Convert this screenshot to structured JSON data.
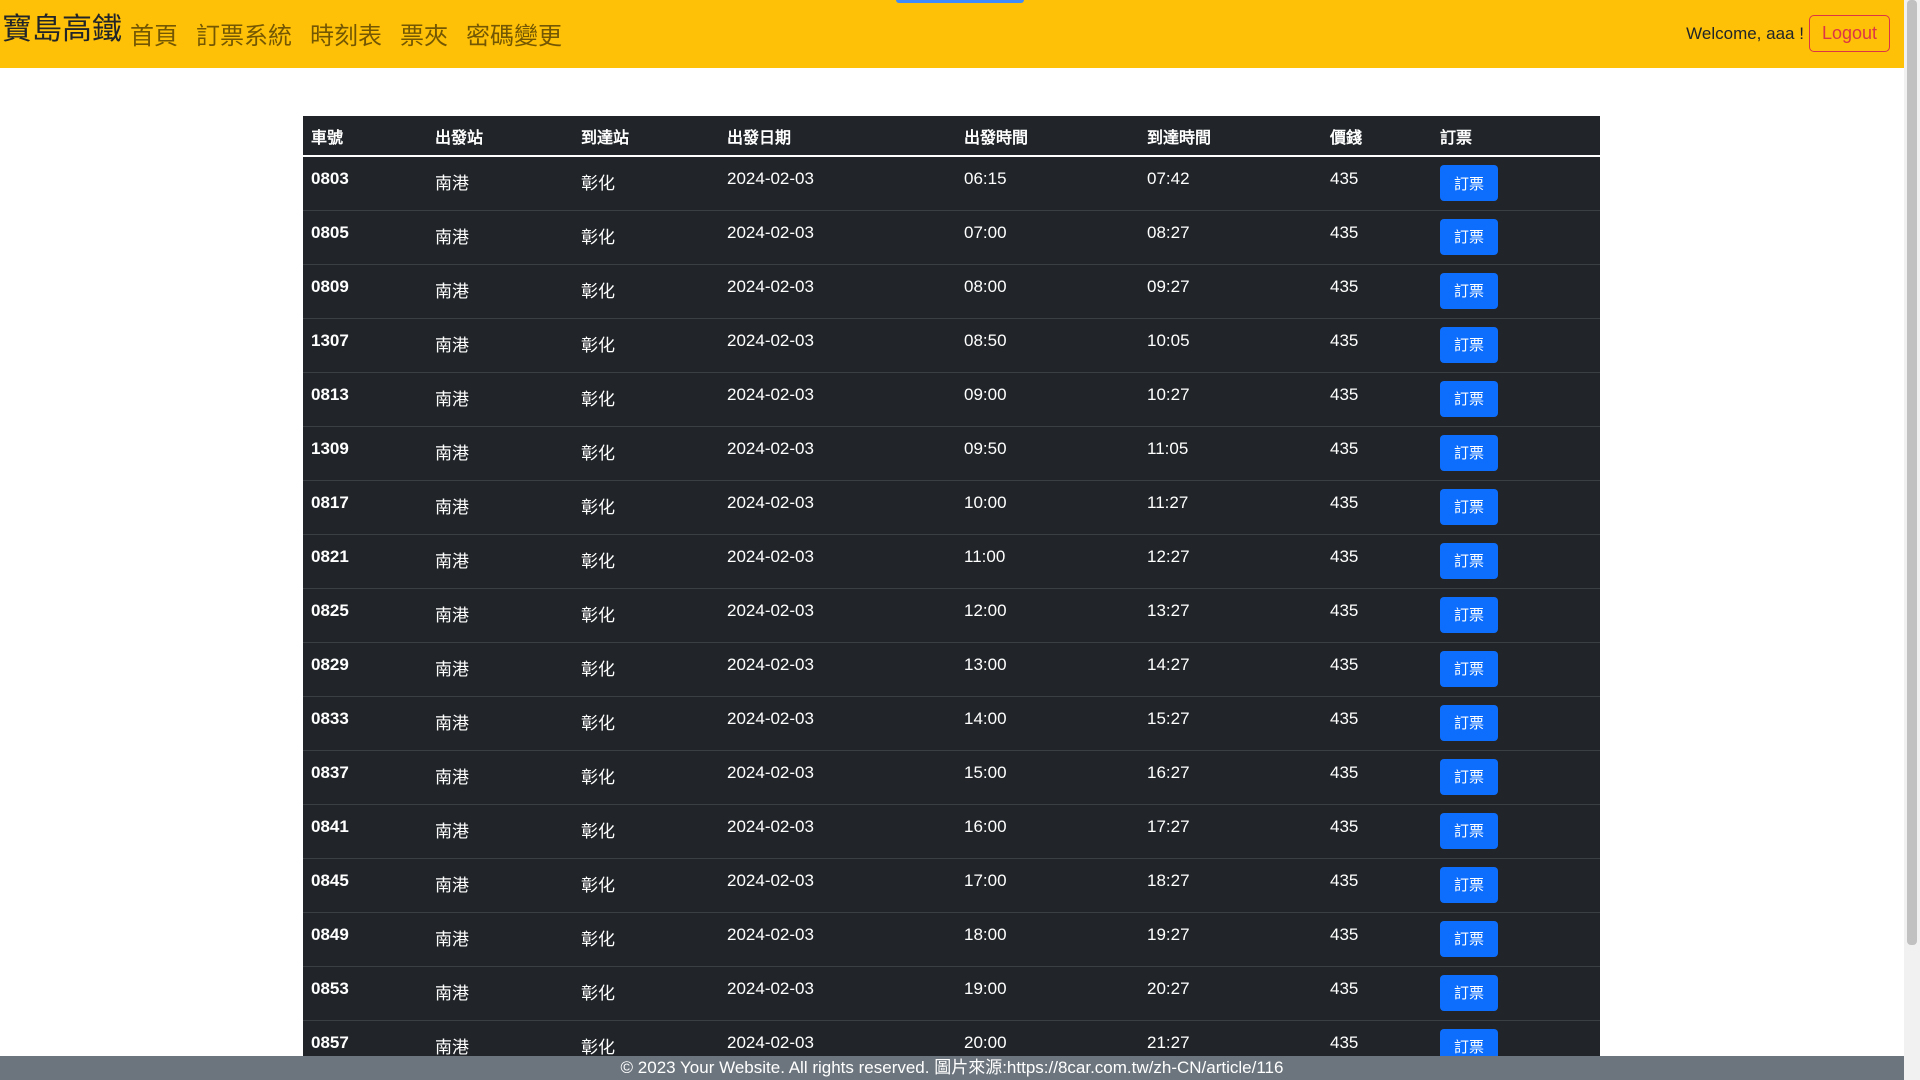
{
  "navbar": {
    "brand": "寶島高鐵",
    "links": [
      {
        "label": "首頁"
      },
      {
        "label": "訂票系統"
      },
      {
        "label": "時刻表"
      },
      {
        "label": "票夾"
      },
      {
        "label": "密碼變更"
      }
    ],
    "welcome": "Welcome, aaa !",
    "logout_label": "Logout"
  },
  "table": {
    "headers": [
      "車號",
      "出發站",
      "到達站",
      "出發日期",
      "出發時間",
      "到達時間",
      "價錢",
      "訂票"
    ],
    "book_label": "訂票",
    "rows": [
      {
        "train": "0803",
        "from": "南港",
        "to": "彰化",
        "date": "2024-02-03",
        "depart": "06:15",
        "arrive": "07:42",
        "price": "435"
      },
      {
        "train": "0805",
        "from": "南港",
        "to": "彰化",
        "date": "2024-02-03",
        "depart": "07:00",
        "arrive": "08:27",
        "price": "435"
      },
      {
        "train": "0809",
        "from": "南港",
        "to": "彰化",
        "date": "2024-02-03",
        "depart": "08:00",
        "arrive": "09:27",
        "price": "435"
      },
      {
        "train": "1307",
        "from": "南港",
        "to": "彰化",
        "date": "2024-02-03",
        "depart": "08:50",
        "arrive": "10:05",
        "price": "435"
      },
      {
        "train": "0813",
        "from": "南港",
        "to": "彰化",
        "date": "2024-02-03",
        "depart": "09:00",
        "arrive": "10:27",
        "price": "435"
      },
      {
        "train": "1309",
        "from": "南港",
        "to": "彰化",
        "date": "2024-02-03",
        "depart": "09:50",
        "arrive": "11:05",
        "price": "435"
      },
      {
        "train": "0817",
        "from": "南港",
        "to": "彰化",
        "date": "2024-02-03",
        "depart": "10:00",
        "arrive": "11:27",
        "price": "435"
      },
      {
        "train": "0821",
        "from": "南港",
        "to": "彰化",
        "date": "2024-02-03",
        "depart": "11:00",
        "arrive": "12:27",
        "price": "435"
      },
      {
        "train": "0825",
        "from": "南港",
        "to": "彰化",
        "date": "2024-02-03",
        "depart": "12:00",
        "arrive": "13:27",
        "price": "435"
      },
      {
        "train": "0829",
        "from": "南港",
        "to": "彰化",
        "date": "2024-02-03",
        "depart": "13:00",
        "arrive": "14:27",
        "price": "435"
      },
      {
        "train": "0833",
        "from": "南港",
        "to": "彰化",
        "date": "2024-02-03",
        "depart": "14:00",
        "arrive": "15:27",
        "price": "435"
      },
      {
        "train": "0837",
        "from": "南港",
        "to": "彰化",
        "date": "2024-02-03",
        "depart": "15:00",
        "arrive": "16:27",
        "price": "435"
      },
      {
        "train": "0841",
        "from": "南港",
        "to": "彰化",
        "date": "2024-02-03",
        "depart": "16:00",
        "arrive": "17:27",
        "price": "435"
      },
      {
        "train": "0845",
        "from": "南港",
        "to": "彰化",
        "date": "2024-02-03",
        "depart": "17:00",
        "arrive": "18:27",
        "price": "435"
      },
      {
        "train": "0849",
        "from": "南港",
        "to": "彰化",
        "date": "2024-02-03",
        "depart": "18:00",
        "arrive": "19:27",
        "price": "435"
      },
      {
        "train": "0853",
        "from": "南港",
        "to": "彰化",
        "date": "2024-02-03",
        "depart": "19:00",
        "arrive": "20:27",
        "price": "435"
      },
      {
        "train": "0857",
        "from": "南港",
        "to": "彰化",
        "date": "2024-02-03",
        "depart": "20:00",
        "arrive": "21:27",
        "price": "435"
      }
    ]
  },
  "footer": {
    "text": "© 2023 Your Website. All rights reserved. 圖片來源:https://8car.com.tw/zh-CN/article/116"
  },
  "colors": {
    "navbar_bg": "#ffc107",
    "table_bg": "#212529",
    "book_button": "#0d6efd",
    "logout": "#dc3545",
    "footer_bg": "#6c757d"
  }
}
